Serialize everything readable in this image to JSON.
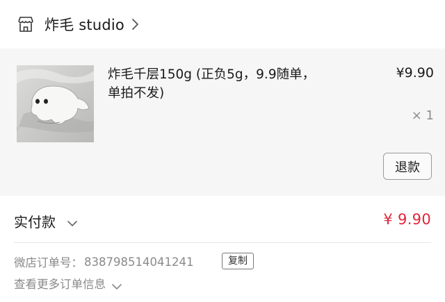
{
  "shop": {
    "name": "炸毛 studio",
    "icon": "shop-storefront-icon",
    "chevron": "chevron-right-icon"
  },
  "item": {
    "image": "product-thumbnail",
    "title": "炸毛千层150g (正负5g，9.9随单，单拍不发)",
    "price": "¥9.90",
    "quantity": "× 1",
    "refund_label": "退款"
  },
  "payment": {
    "label": "实付款",
    "amount": "¥ 9.90",
    "amount_color": "#e0263b"
  },
  "order": {
    "number_label": "微店订单号：",
    "number_value": "838798514041241",
    "copy_label": "复制",
    "more_label": "查看更多订单信息"
  }
}
